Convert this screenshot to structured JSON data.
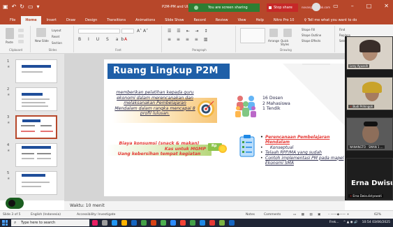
{
  "titlebar": {
    "doc_title": "P2M-PM and Ul...",
    "share_status": "You are screen sharing",
    "stop_share": "Stop share",
    "account": "novan@outlook.com"
  },
  "tabs": [
    "File",
    "Home",
    "Insert",
    "Draw",
    "Design",
    "Transitions",
    "Animations",
    "Slide Show",
    "Record",
    "Review",
    "View",
    "Help",
    "Nitro Pro 10"
  ],
  "active_tab": "Home",
  "tell_me": "Tell me what you want to do",
  "ribbon": {
    "groups": [
      "Clipboard",
      "Slides",
      "Font",
      "Paragraph",
      "Drawing",
      "Editing"
    ],
    "paste": "Paste",
    "new_slide": "New Slide",
    "layout": "Layout",
    "reset": "Reset",
    "section": "Section",
    "arrange": "Arrange",
    "quick_styles": "Quick Styles",
    "shape_fill": "Shape Fill",
    "shape_outline": "Shape Outline",
    "shape_effects": "Shape Effects",
    "find": "Find",
    "replace": "Replace",
    "select": "Select"
  },
  "thumbnails": [
    {
      "num": "1",
      "selected": false
    },
    {
      "num": "2",
      "selected": false
    },
    {
      "num": "3",
      "selected": true
    },
    {
      "num": "4",
      "selected": false
    },
    {
      "num": "5",
      "selected": false
    }
  ],
  "slide": {
    "title": "Ruang Lingkup P2M",
    "objective": "memberikan pelatihan kepada guru ekonomi dalam merencanakan dan melaksanakan Pembelajaran Mendalam dalam rangka mencapai 8 profil lulusan.",
    "participants": [
      "16 Dosen",
      "2 Mahasiswa",
      "1 Tendik"
    ],
    "costs": [
      "Biaya konsumsi (snack & makan)",
      "Kas untuk MGMP",
      "Uang kebersihan tempat kegiatan"
    ],
    "outputs": [
      "Perencanaan Pembelajaran Mendalam",
      "Konseptual",
      "Telaah RPP/MA yang sudah",
      "Contoh implementasi PM pada mapel Ekonomi SMA"
    ],
    "rp_badge": "Rp"
  },
  "notes_text": "Waktu: 10 menit",
  "statusbar": {
    "slide_of": "Slide 3 of 5",
    "language": "English (Indonesia)",
    "accessibility": "Accessibility: Investigate",
    "notes": "Notes",
    "comments": "Comments",
    "zoom": "62%"
  },
  "zoom_panel": {
    "tiles": [
      {
        "name": "Leny Ayuasih"
      },
      {
        "name": "Budi Prihingoh"
      },
      {
        "name": "NANANGTO - SMAN 1 ..."
      },
      {
        "name": "Erna Dwisulistyowati",
        "big_label": "Erna Dwisuli"
      }
    ]
  },
  "taskbar": {
    "search_placeholder": "Type here to search",
    "app_label": "Frek...",
    "time": "10:54",
    "date": "03/06/2025"
  },
  "colors": {
    "ppt_red": "#b7472a",
    "slide_title_blue": "#1f5fa8",
    "accent_red": "#e53935"
  }
}
